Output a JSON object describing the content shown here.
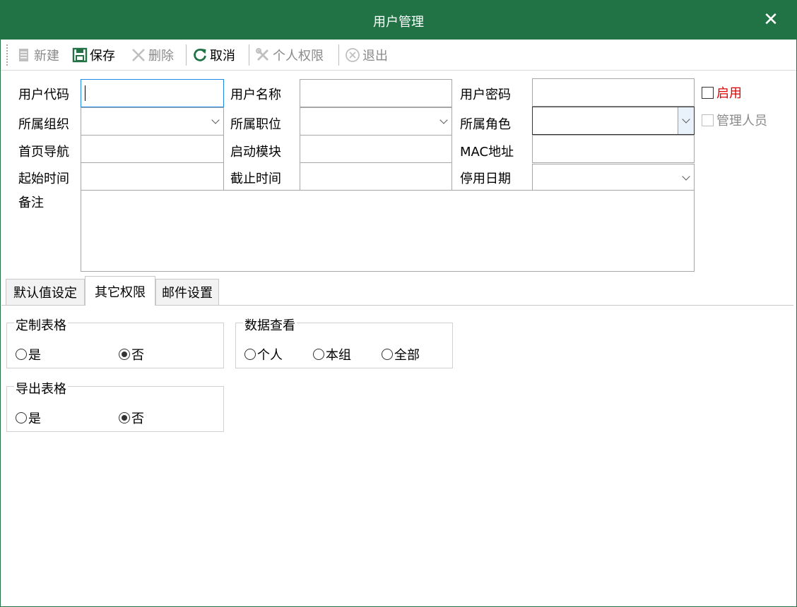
{
  "window": {
    "title": "用户管理",
    "close_glyph": "✕"
  },
  "toolbar": {
    "items": [
      {
        "label": "新建",
        "icon": "new-doc-icon",
        "enabled": false
      },
      {
        "label": "保存",
        "icon": "save-icon",
        "enabled": true
      },
      {
        "label": "删除",
        "icon": "delete-x-icon",
        "enabled": false
      },
      {
        "label": "取消",
        "icon": "refresh-icon",
        "enabled": true
      },
      {
        "label": "个人权限",
        "icon": "tools-icon",
        "enabled": false
      },
      {
        "label": "退出",
        "icon": "exit-circle-icon",
        "enabled": false
      }
    ]
  },
  "form": {
    "user_code": {
      "label": "用户代码",
      "value": ""
    },
    "user_name": {
      "label": "用户名称",
      "value": ""
    },
    "password": {
      "label": "用户密码",
      "value": ""
    },
    "organization": {
      "label": "所属组织",
      "value": ""
    },
    "position": {
      "label": "所属职位",
      "value": ""
    },
    "role": {
      "label": "所属角色",
      "value": ""
    },
    "home_nav": {
      "label": "首页导航",
      "value": ""
    },
    "start_module": {
      "label": "启动模块",
      "value": ""
    },
    "mac": {
      "label": "MAC地址",
      "value": ""
    },
    "start_time": {
      "label": "起始时间",
      "value": ""
    },
    "end_time": {
      "label": "截止时间",
      "value": ""
    },
    "disable_date": {
      "label": "停用日期",
      "value": ""
    },
    "remark": {
      "label": "备注",
      "value": ""
    },
    "enabled": {
      "label": "启用",
      "checked": false
    },
    "admin": {
      "label": "管理人员",
      "checked": false,
      "disabled": true
    }
  },
  "tabs": [
    {
      "label": "默认值设定",
      "active": false
    },
    {
      "label": "其它权限",
      "active": true
    },
    {
      "label": "邮件设置",
      "active": false
    }
  ],
  "panel": {
    "custom_table": {
      "title": "定制表格",
      "options": [
        "是",
        "否"
      ],
      "selected": "否"
    },
    "data_view": {
      "title": "数据查看",
      "options": [
        "个人",
        "本组",
        "全部"
      ],
      "selected": ""
    },
    "export_table": {
      "title": "导出表格",
      "options": [
        "是",
        "否"
      ],
      "selected": "否"
    }
  },
  "colors": {
    "accent": "#217346",
    "required_label": "#e00000",
    "focus_border": "#1e88e5"
  }
}
